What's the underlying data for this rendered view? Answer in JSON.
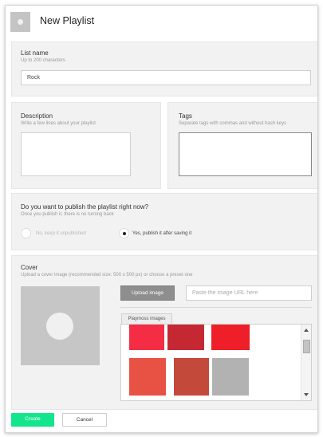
{
  "header": {
    "title": "New Playlist",
    "thumbnail_icon": "playlist-image-placeholder"
  },
  "list_name": {
    "label": "List name",
    "hint": "Up to 200 characters",
    "value": "Rock"
  },
  "description": {
    "label": "Description",
    "hint": "Write a few lines about your playlist",
    "value": ""
  },
  "tags": {
    "label": "Tags",
    "hint": "Separate tags with commas and without hash keys",
    "value": ""
  },
  "publish": {
    "question": "Do you want to publish the playlist right now?",
    "hint": "Once you publish it, there is no turning back",
    "options": [
      {
        "label": "No, keep it unpublished",
        "selected": false
      },
      {
        "label": "Yes, publish it after saving it",
        "selected": true
      }
    ]
  },
  "cover": {
    "label": "Cover",
    "hint": "Upload a cover image (recommended size: 500 x 500 px) or choose a preset one",
    "upload_button": "Upload image",
    "url_placeholder": "Paste the image URL here",
    "gallery_tab": "Playmoss images",
    "swatch_colors": [
      "#f42c44",
      "#c52833",
      "#ee1f28",
      "#e85245",
      "#c34a3b",
      "#b2b2b2"
    ]
  },
  "footer": {
    "create": "Create",
    "cancel": "Cancel"
  },
  "colors": {
    "accent": "#12e58c",
    "panel_bg": "#f2f2f2"
  }
}
